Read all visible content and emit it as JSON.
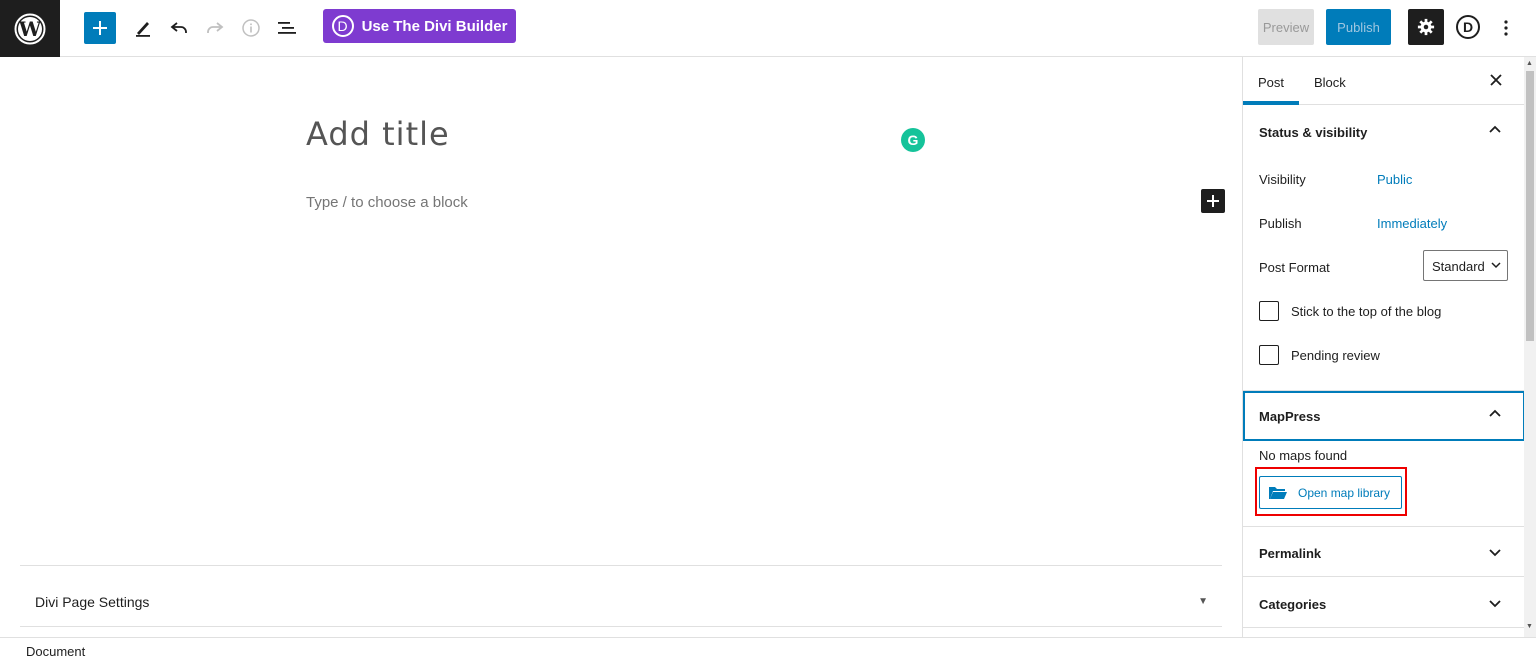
{
  "toolbar": {
    "add_icon": "plus-icon",
    "tools_icon": "pencil-icon",
    "undo_icon": "undo-icon",
    "redo_icon": "redo-icon",
    "info_icon": "info-icon",
    "list_view_icon": "list-view-icon",
    "divi_button_label": "Use The Divi Builder",
    "divi_logo_letter": "D",
    "preview_label": "Preview",
    "publish_label": "Publish",
    "settings_icon": "gear-icon",
    "avatar_letter": "D",
    "more_icon": "kebab-icon"
  },
  "editor": {
    "title_placeholder": "Add title",
    "block_placeholder": "Type / to choose a block",
    "grammarly_letter": "G"
  },
  "divi_page_settings": {
    "title": "Divi Page Settings"
  },
  "footer": {
    "breadcrumb": "Document"
  },
  "sidebar": {
    "tabs": [
      {
        "label": "Post",
        "active": true
      },
      {
        "label": "Block",
        "active": false
      }
    ],
    "status_visibility": {
      "title": "Status & visibility",
      "visibility_label": "Visibility",
      "visibility_value": "Public",
      "publish_label": "Publish",
      "publish_value": "Immediately",
      "post_format_label": "Post Format",
      "post_format_value": "Standard",
      "sticky_label": "Stick to the top of the blog",
      "sticky_checked": false,
      "pending_label": "Pending review",
      "pending_checked": false
    },
    "mappress": {
      "title": "MapPress",
      "no_maps": "No maps found",
      "open_library_label": "Open map library"
    },
    "permalink": {
      "title": "Permalink"
    },
    "categories": {
      "title": "Categories"
    }
  },
  "colors": {
    "accent": "#007cba",
    "divi_purple": "#7e3bd0",
    "dark": "#1e1e1e",
    "highlight_red": "#ee0000",
    "grammarly_green": "#15c39a"
  }
}
